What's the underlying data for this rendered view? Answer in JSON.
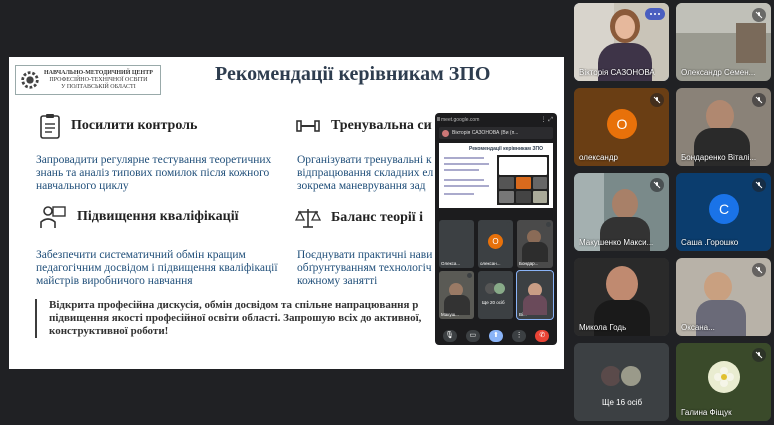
{
  "slide": {
    "logo_line1": "НАВЧАЛЬНО-МЕТОДИЧНИЙ ЦЕНТР",
    "logo_line2": "ПРОФЕСІЙНО-ТЕХНІЧНОЇ ОСВІТИ",
    "logo_line3": "У ПОЛТАВСЬКІЙ ОБЛАСТІ",
    "title": "Рекомендації керівникам ЗПО",
    "sections": [
      {
        "heading": "Посилити контроль",
        "icon": "clipboard-icon",
        "text": "Запровадити регулярне тестування теоретичних знань та аналіз типових помилок після кожного навчального циклу"
      },
      {
        "heading": "Тренувальна си",
        "icon": "dumbbell-icon",
        "text": "Організувати тренувальні к відпрацювання складних ел зокрема маневрування зад"
      },
      {
        "heading": "Підвищення кваліфікації",
        "icon": "teacher-icon",
        "text": "Забезпечити систематичний обмін кращим педагогічним досвідом і підвищення кваліфікації майстрів виробничого навчання"
      },
      {
        "heading": "Баланс теорії і",
        "icon": "scales-icon",
        "text": "Поєднувати практичні нави обґрунтуванням технологіч кожному занятті"
      }
    ],
    "quote": "Відкрита професійна дискусія, обмін досвідом та спільне напрацювання р підвищення якості професійної освіти області. Запрошую всіх до активної, конструктивної роботи!"
  },
  "phone": {
    "url": "meet.google.com",
    "presenter": "Вікторія САЗОНОВА (Ви (п...",
    "mini_title": "Рекомендації керівникам ЗПО",
    "tiles": [
      {
        "name": "Олекса..."
      },
      {
        "name": "олексан...",
        "initial": "О"
      },
      {
        "name": "Бондар..."
      },
      {
        "name": "Макуш..."
      },
      {
        "name": "Ще 20 осіб"
      },
      {
        "name": "Ві..."
      }
    ]
  },
  "participants": [
    {
      "name": "Вікторія САЗОНОВА",
      "active": true
    },
    {
      "name": "Олександр Семен..."
    },
    {
      "name": "олександр",
      "initial": "О",
      "color": "#e8710a"
    },
    {
      "name": "Бондаренко Віталі..."
    },
    {
      "name": "Макушенко Макси..."
    },
    {
      "name": "Саша .Горошко",
      "initial": "С",
      "color": "#1a73e8"
    },
    {
      "name": "Микола Годь"
    },
    {
      "name": "Оксана..."
    },
    {
      "name": "Ще 16 осіб"
    },
    {
      "name": "Галина Фіщук"
    }
  ],
  "colors": {
    "background": "#202124",
    "title": "#2e3d4f",
    "body_text": "#1f4e79"
  }
}
